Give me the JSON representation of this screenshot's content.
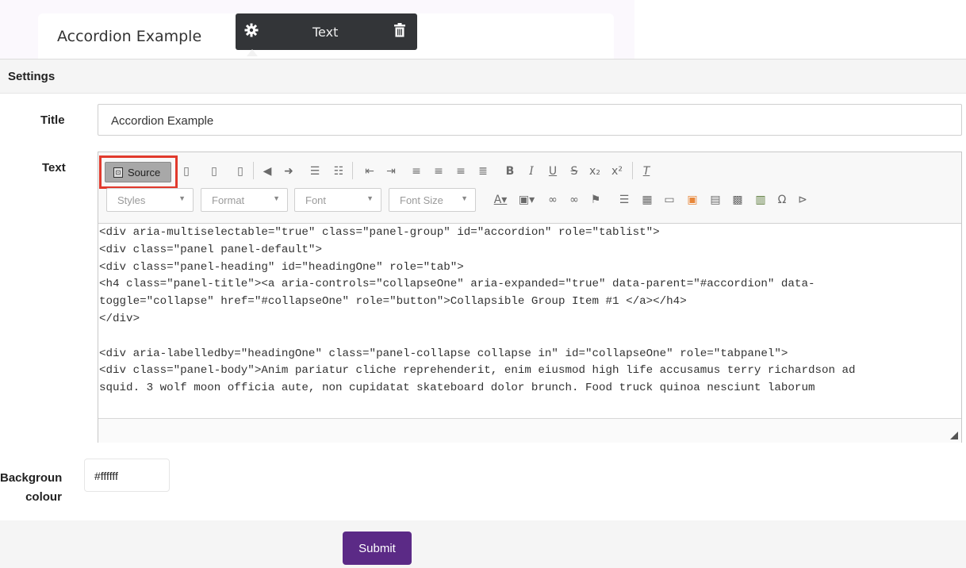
{
  "preview": {
    "title": "Accordion Example"
  },
  "popover": {
    "label": "Text",
    "icons": [
      "gear-icon",
      "trash-icon"
    ]
  },
  "settings": {
    "header": "Settings"
  },
  "form": {
    "title_label": "Title",
    "title_value": "Accordion Example",
    "text_label": "Text",
    "background_label_line1": "Backgroun",
    "background_label_line2": "colour",
    "background_value": "#ffffff",
    "submit_label": "Submit"
  },
  "editor": {
    "source_button": "Source",
    "selects": {
      "styles": "Styles",
      "format": "Format",
      "font": "Font",
      "font_size": "Font Size"
    },
    "toolbar_row1_icons": [
      "copy-icon",
      "paste-text-icon",
      "paste-word-icon",
      "undo-icon",
      "redo-icon",
      "numbered-list-icon",
      "bulleted-list-icon",
      "outdent-icon",
      "indent-icon",
      "align-left-icon",
      "align-center-icon",
      "align-right-icon",
      "justify-icon",
      "bold-icon",
      "italic-icon",
      "underline-icon",
      "strikethrough-icon",
      "subscript-icon",
      "superscript-icon",
      "remove-format-icon"
    ],
    "toolbar_row2_icons": [
      "text-color-icon",
      "background-color-icon",
      "link-icon",
      "unlink-icon",
      "anchor-icon",
      "horizontal-line-icon",
      "table-icon",
      "image-icon",
      "iframe-icon",
      "youtube-icon",
      "video-icon",
      "media-icon",
      "special-character-icon",
      "show-blocks-icon"
    ],
    "source_lines": [
      "<div aria-multiselectable=\"true\" class=\"panel-group\" id=\"accordion\" role=\"tablist\">",
      "<div class=\"panel panel-default\">",
      "<div class=\"panel-heading\" id=\"headingOne\" role=\"tab\">",
      "<h4 class=\"panel-title\"><a aria-controls=\"collapseOne\" aria-expanded=\"true\" data-parent=\"#accordion\" data-",
      "toggle=\"collapse\" href=\"#collapseOne\" role=\"button\">Collapsible Group Item #1 </a></h4>",
      "</div>",
      "",
      "<div aria-labelledby=\"headingOne\" class=\"panel-collapse collapse in\" id=\"collapseOne\" role=\"tabpanel\">",
      "<div class=\"panel-body\">Anim pariatur cliche reprehenderit, enim eiusmod high life accusamus terry richardson ad",
      "squid. 3 wolf moon officia aute, non cupidatat skateboard dolor brunch. Food truck quinoa nesciunt laborum"
    ]
  },
  "colors": {
    "submit_bg": "#5b2a86",
    "popover_bg": "#333538",
    "highlight": "#e13a2d"
  }
}
